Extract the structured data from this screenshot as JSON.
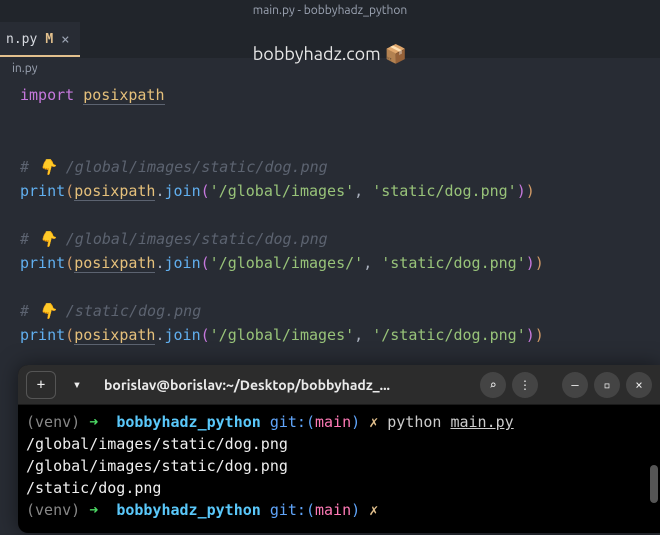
{
  "window": {
    "title": "main.py - bobbyhadz_python"
  },
  "watermark": "bobbyhadz.com 📦",
  "tab": {
    "filename": "n.py",
    "git_status": "M",
    "close": "×"
  },
  "breadcrumb": "in.py",
  "code": {
    "l1_import": "import",
    "l1_mod": "posixpath",
    "c1": "# 👇 /global/images/static/dog.png",
    "print": "print",
    "posixpath": "posixpath",
    "join": "join",
    "s_global": "'/global/images'",
    "s_global_slash": "'/global/images/'",
    "s_static_rel": "'static/dog.png'",
    "s_static_abs": "'/static/dog.png'",
    "c2": "# 👇 /global/images/static/dog.png",
    "c3": "# 👇 /static/dog.png",
    "comma": ", ",
    "dot": "."
  },
  "terminal": {
    "title": "borislav@borislav:~/Desktop/bobbyhadz_...",
    "prompt": {
      "venv": "(venv)",
      "arrow": "➜",
      "dir": "bobbyhadz_python",
      "git_label": "git:(",
      "branch": "main",
      "git_close": ")",
      "x": "✗"
    },
    "cmd1": "python ",
    "cmd1_file": "main.py",
    "out1": "/global/images/static/dog.png",
    "out2": "/global/images/static/dog.png",
    "out3": "/static/dog.png",
    "buttons": {
      "newtab": "+",
      "dropdown": "▾",
      "search": "⌕",
      "menu": "⋮",
      "min": "–",
      "max": "▫",
      "close": "×"
    }
  }
}
